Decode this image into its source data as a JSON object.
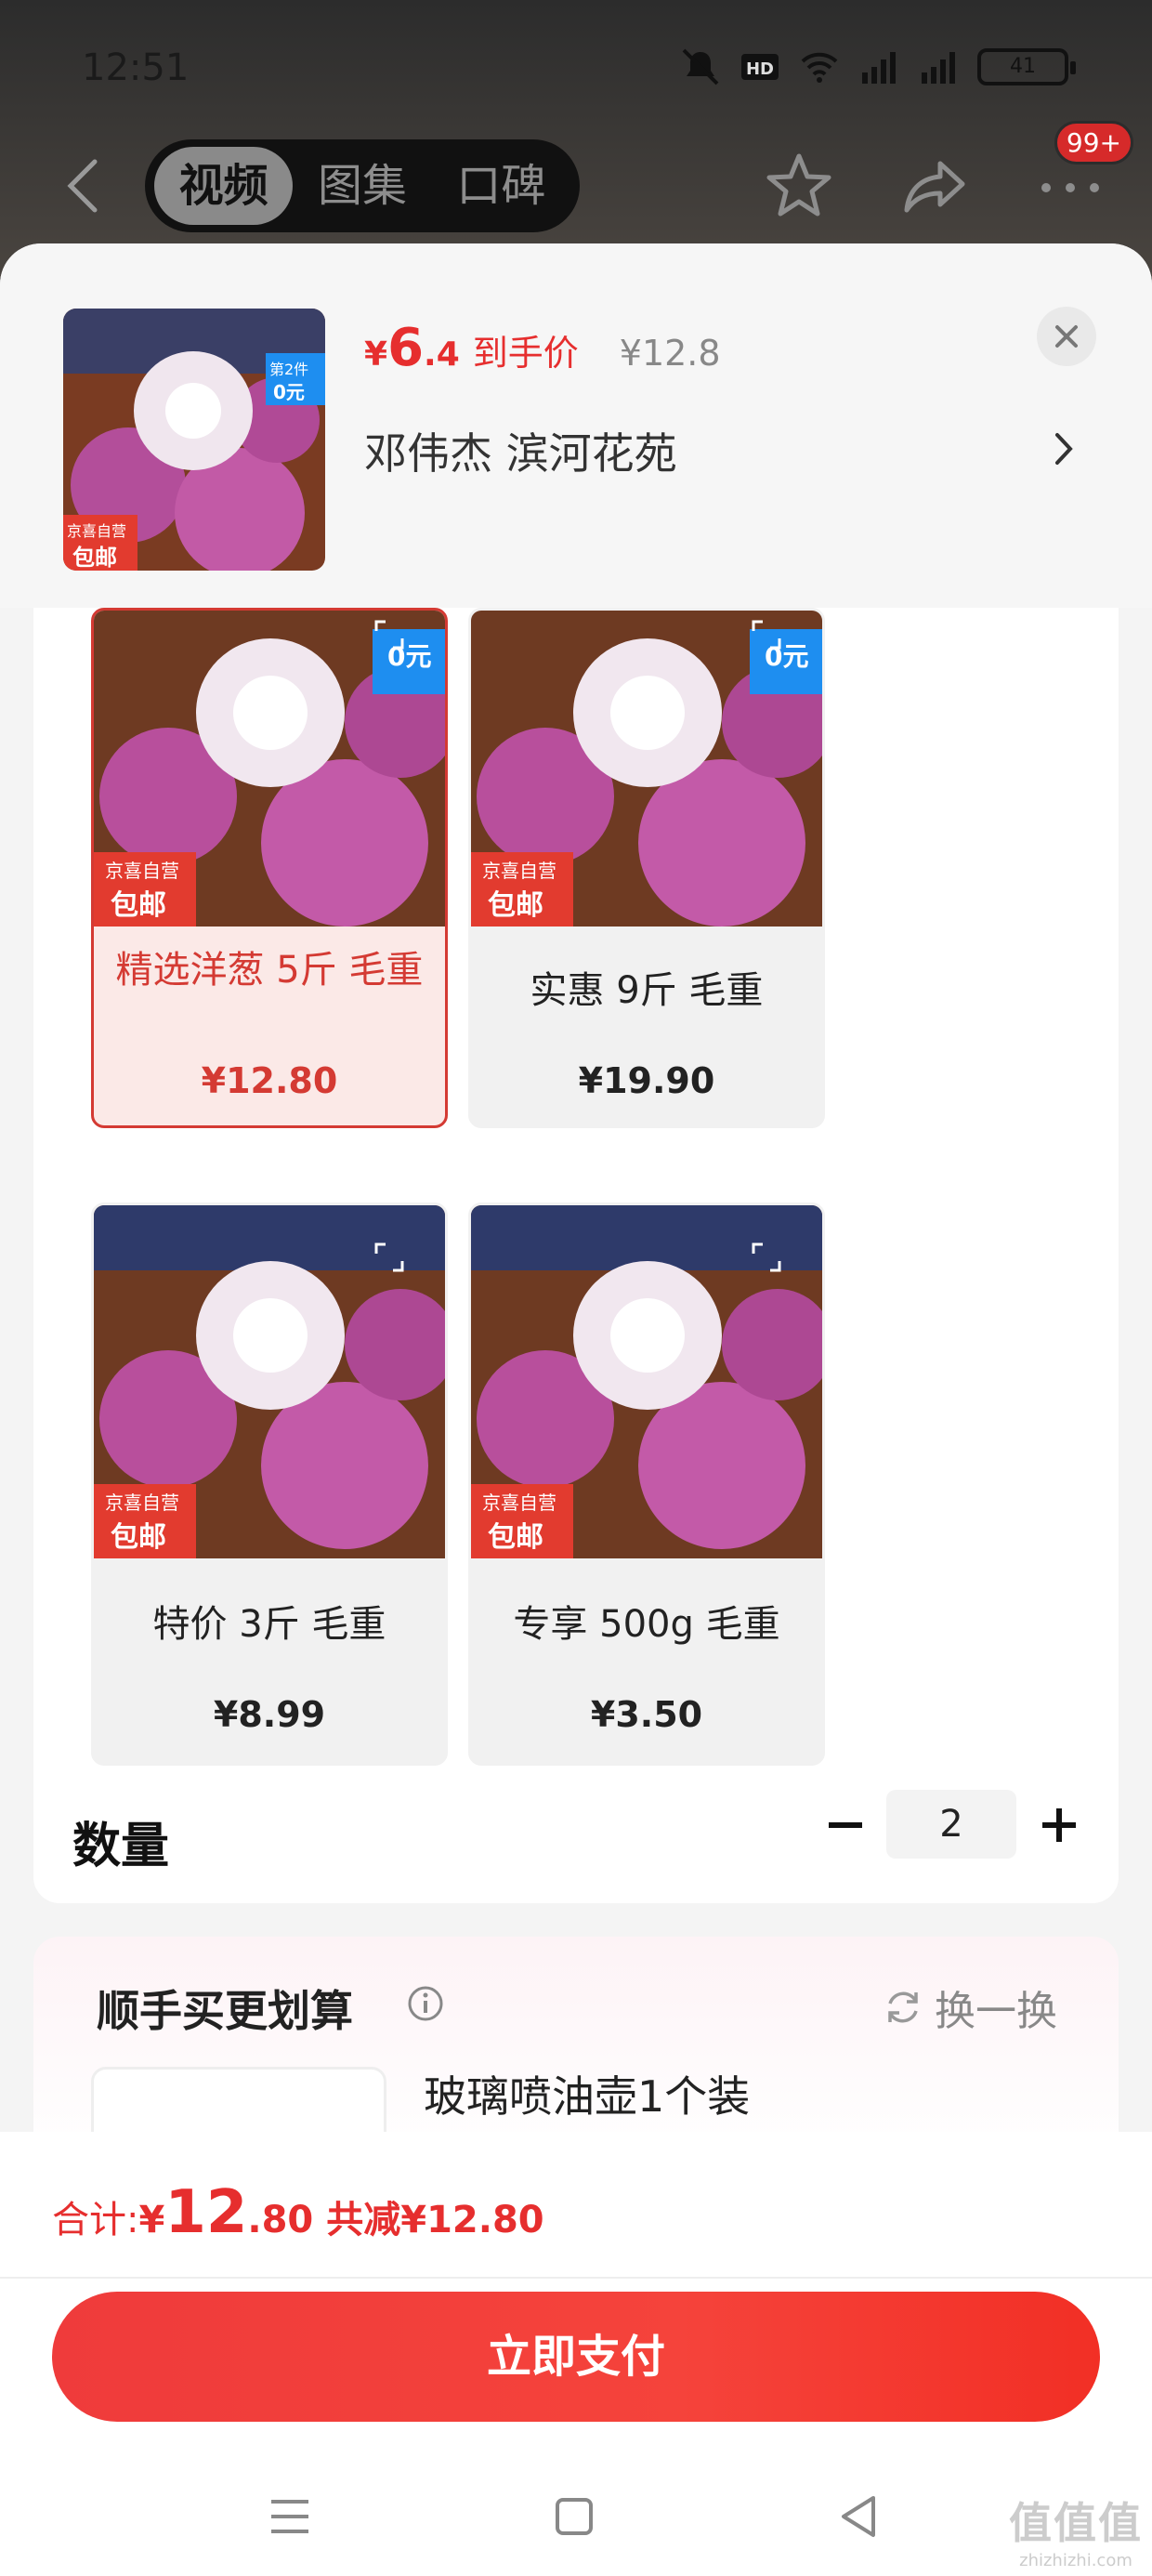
{
  "status_bar": {
    "time": "12:51",
    "battery": "41",
    "network_1": "5G",
    "network_2": "5G",
    "hd": "HD"
  },
  "nav": {
    "tabs": [
      {
        "label": "视频",
        "active": true
      },
      {
        "label": "图集",
        "active": false
      },
      {
        "label": "口碑",
        "active": false
      }
    ],
    "more_badge": "99+"
  },
  "header": {
    "currency": "¥",
    "price_int": "6",
    "price_dec": ".4",
    "price_tag": "到手价",
    "original_price": "¥12.8",
    "address": "邓伟杰  滨河花苑"
  },
  "thumb_badges": {
    "promo_line1": "第2件",
    "promo_line2": "0元",
    "store": "京喜自营",
    "shipping": "包邮"
  },
  "options": [
    {
      "name": "精选洋葱 5斤 毛重",
      "price": "¥12.80",
      "selected": true,
      "promo": true
    },
    {
      "name": "实惠 9斤 毛重",
      "price": "¥19.90",
      "selected": false,
      "promo": true
    },
    {
      "name": "特价 3斤 毛重",
      "price": "¥8.99",
      "selected": false,
      "promo": false
    },
    {
      "name": "专享 500g 毛重",
      "price": "¥3.50",
      "selected": false,
      "promo": false
    }
  ],
  "quantity": {
    "label": "数量",
    "value": "2"
  },
  "upsell": {
    "title": "顺手买更划算",
    "swap_label": "换一换",
    "item_name": "玻璃喷油壶1个装"
  },
  "footer": {
    "total_label": "合计: ",
    "total_currency": "¥",
    "total_int": "12",
    "total_dec": ".80",
    "discount_text": "共减¥12.80",
    "pay_label": "立即支付"
  },
  "watermark": {
    "text": "值值值",
    "sub": "zhizhizhi.com"
  },
  "colors": {
    "accent": "#e62e2e",
    "selected_bg": "#fbe9e7",
    "pay_button": "#f5433b"
  }
}
